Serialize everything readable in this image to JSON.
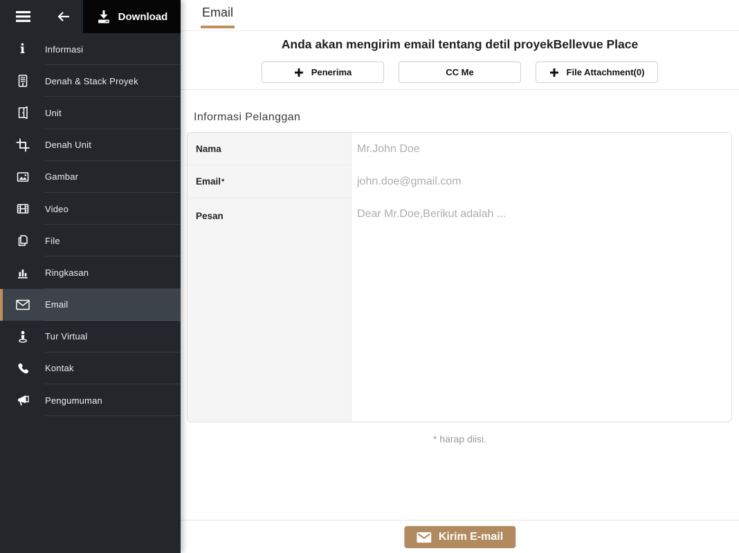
{
  "topbar": {
    "hamburger_icon": "menu-icon",
    "back_icon": "arrow-left-icon",
    "download": {
      "label": "Download",
      "icon": "download-icon"
    }
  },
  "sidebar": {
    "items": [
      {
        "label": "Informasi",
        "icon": "info-icon",
        "selected": false
      },
      {
        "label": "Denah & Stack Proyek",
        "icon": "building-icon",
        "selected": false
      },
      {
        "label": "Unit",
        "icon": "door-icon",
        "selected": false
      },
      {
        "label": "Denah Unit",
        "icon": "crop-icon",
        "selected": false
      },
      {
        "label": "Gambar",
        "icon": "image-icon",
        "selected": false
      },
      {
        "label": "Video",
        "icon": "film-icon",
        "selected": false
      },
      {
        "label": "File",
        "icon": "copy-icon",
        "selected": false
      },
      {
        "label": "Ringkasan",
        "icon": "bar-chart-icon",
        "selected": false
      },
      {
        "label": "Email",
        "icon": "envelope-icon",
        "selected": true
      },
      {
        "label": "Tur Virtual",
        "icon": "street-view-icon",
        "selected": false
      },
      {
        "label": "Kontak",
        "icon": "phone-icon",
        "selected": false
      },
      {
        "label": "Pengumuman",
        "icon": "megaphone-icon",
        "selected": false
      }
    ]
  },
  "main": {
    "tab": {
      "label": "Email"
    },
    "heading": "Anda akan mengirim email tentang detil proyekBellevue Place",
    "actions": {
      "penerima": {
        "label": "Penerima",
        "icon": "plus-icon"
      },
      "cc_me": {
        "label": "CC Me"
      },
      "file_attachment": {
        "label": "File Attachment(0)",
        "icon": "plus-icon"
      }
    },
    "form": {
      "section_title": "Informasi Pelanggan",
      "fields": {
        "nama": {
          "label": "Nama",
          "placeholder": "Mr.John Doe"
        },
        "email": {
          "label": "Email",
          "required_mark": "*",
          "placeholder": "john.doe@gmail.com"
        },
        "pesan": {
          "label": "Pesan",
          "placeholder": "Dear Mr.Doe,Berikut adalah ..."
        }
      },
      "required_note": "* harap diisi."
    },
    "submit": {
      "label": "Kirim E-mail",
      "icon": "envelope-icon"
    }
  },
  "colors": {
    "accent_tan": "#bf8e5d",
    "submit_button": "#b18a5f",
    "sidebar_bg": "#23272c",
    "sidebar_selected_bg": "#3d434a",
    "download_button_bg": "#060606",
    "label_column_bg": "#f5f5f5"
  }
}
